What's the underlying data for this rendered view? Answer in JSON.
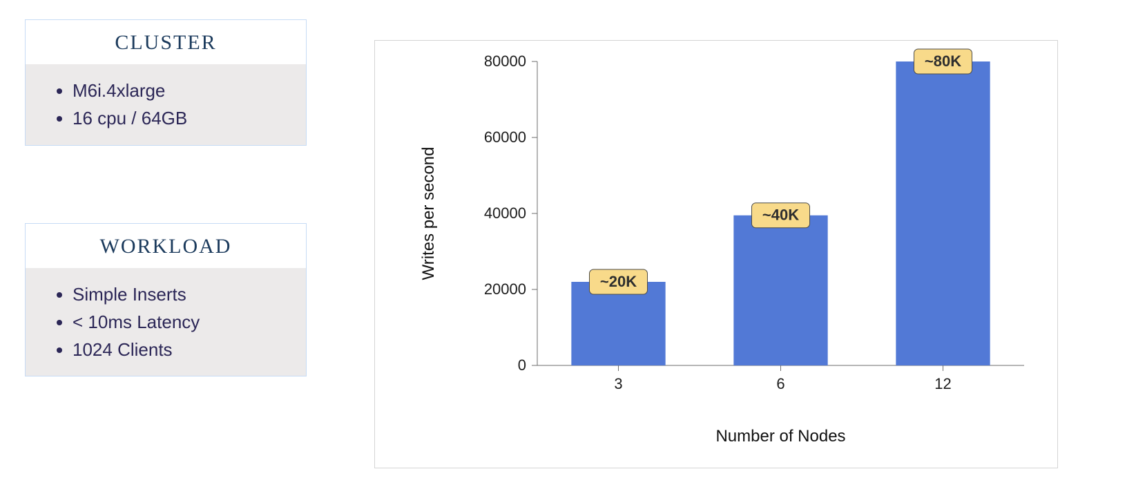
{
  "left": {
    "cluster": {
      "title": "CLUSTER",
      "items": [
        "M6i.4xlarge",
        "16 cpu / 64GB"
      ]
    },
    "workload": {
      "title": "WORKLOAD",
      "items": [
        "Simple Inserts",
        "< 10ms Latency",
        "1024 Clients"
      ]
    }
  },
  "chart_data": {
    "type": "bar",
    "categories": [
      "3",
      "6",
      "12"
    ],
    "values": [
      22000,
      39500,
      80000
    ],
    "value_labels": [
      "~20K",
      "~40K",
      "~80K"
    ],
    "xlabel": "Number of Nodes",
    "ylabel": "Writes per second",
    "ylim": [
      0,
      80000
    ],
    "yticks": [
      0,
      20000,
      40000,
      60000,
      80000
    ],
    "ytick_labels": [
      "0",
      "20000",
      "40000",
      "60000",
      "80000"
    ],
    "bar_color": "#5279d6",
    "badge_bg": "#f8da8a"
  }
}
